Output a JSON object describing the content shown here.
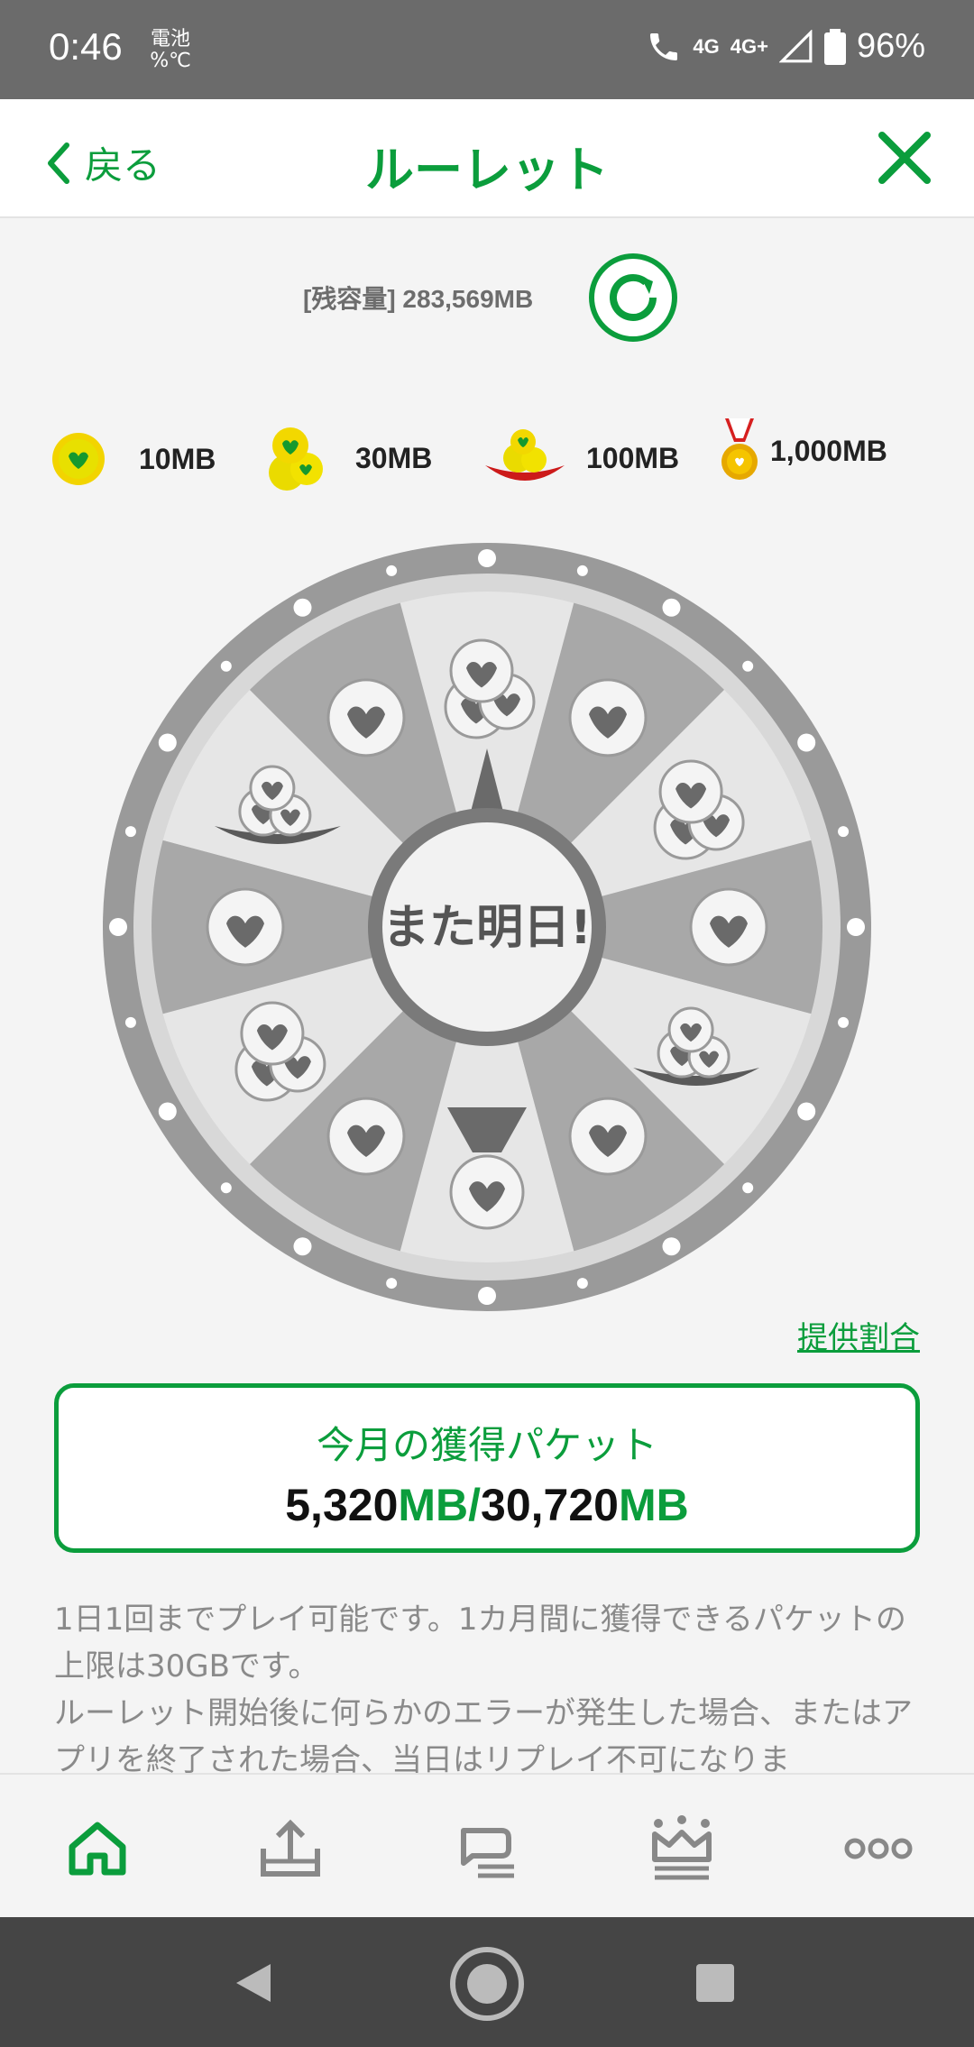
{
  "status_bar": {
    "time": "0:46",
    "battery_label_line1": "電池",
    "battery_label_line2": "%℃",
    "network": "4G",
    "network2": "4G+",
    "battery_percent": "96%"
  },
  "header": {
    "back_label": "戻る",
    "title": "ルーレット"
  },
  "remaining": "[残容量] 283,569MB",
  "legend": [
    {
      "icon": "single-coin-icon",
      "label": "10MB"
    },
    {
      "icon": "coin-pile-icon",
      "label": "30MB"
    },
    {
      "icon": "coin-tray-icon",
      "label": "100MB"
    },
    {
      "icon": "medal-icon",
      "label": "1,000MB"
    }
  ],
  "wheel": {
    "center_text": "また明日!",
    "segments": [
      "coin-pile",
      "single-coin",
      "coin-pile",
      "single-coin",
      "coin-tray",
      "single-coin",
      "medal",
      "single-coin",
      "coin-pile",
      "single-coin",
      "coin-tray",
      "single-coin"
    ]
  },
  "odds_link": "提供割合",
  "monthly": {
    "label": "今月の獲得パケット",
    "earned": "5,320",
    "earned_unit": "MB",
    "separator": "/",
    "limit": "30,720",
    "limit_unit": "MB"
  },
  "notes": [
    "1日1回までプレイ可能です。1カ月間に獲得できるパケットの上限は30GBです。",
    "ルーレット開始後に何らかのエラーが発生した場合、またはアプリを終了された場合、当日はリプレイ不可になりま"
  ],
  "tabs": [
    "home-tab",
    "data-charge-tab",
    "chat-tab",
    "rank-tab",
    "more-tab"
  ],
  "colors": {
    "accent": "#0b9d3c",
    "statusbar": "#6b6b6b",
    "navbar": "#454545"
  }
}
